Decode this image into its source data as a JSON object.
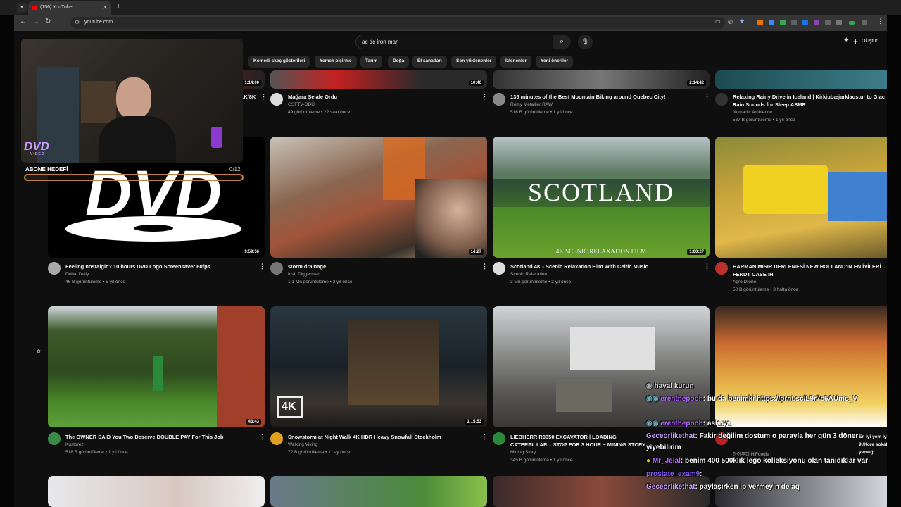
{
  "browser": {
    "tab_title": "(156) YouTube",
    "url": "youtube.com"
  },
  "header": {
    "search_query": "ac dc iron man",
    "create_label": "Oluştur"
  },
  "chips": [
    "Komedi skeç gösterileri",
    "Yemek pişirme",
    "Tarım",
    "Doğa",
    "El sanatları",
    "Son yüklenenler",
    "İzlenenler",
    "Yeni öneriler"
  ],
  "row1": [
    {
      "title": "...K/8K",
      "duration": "1:14:00"
    },
    {
      "title": "Mağara Şelale Ordu",
      "channel": "GSFTV-ODÜ",
      "meta": "49 görüntüleme • 22 saat önce",
      "duration": "10:46"
    },
    {
      "title": "135 minutes of the Best Mountain Biking around Quebec City!",
      "channel": "Rémy Métailler RAW",
      "meta": "516 B görüntüleme • 1 yıl önce",
      "duration": "2:14:42"
    },
    {
      "title": "Relaxing Rainy Drive in Iceland | Kirkjubæjarklaustur to Glac Rain Sounds for Sleep ASMR",
      "channel": "Nomadic Ambience",
      "meta": "537 B görüntüleme • 1 yıl önce"
    }
  ],
  "row2": [
    {
      "title": "Feeling nostalgic? 10 hours DVD Logo Screensaver 60fps",
      "channel": "Dubai Daily",
      "meta": "46 B görüntüleme • 5 yıl önce",
      "duration": "9:59:56"
    },
    {
      "title": "storm drainage",
      "channel": "Irish Diggerman",
      "meta": "1,1 Mn görüntüleme • 2 yıl önce",
      "duration": "14:27"
    },
    {
      "title": "Scotland 4K - Scenic Relaxation Film With Celtic Music",
      "channel": "Scenic Relaxation",
      "meta": "3 Mn görüntüleme • 3 yıl önce",
      "duration": "1:00:27",
      "thumb_title": "SCOTLAND",
      "thumb_sub": "4K SCENIC RELAXATION FILM"
    },
    {
      "title": "HARMAN MISIR DERLEMESİ NEW HOLLAND'IN EN İYİLERİ .. FENDT CASE IH",
      "channel": "Agro Drone",
      "meta": "50 B görüntüleme • 3 hafta önce"
    }
  ],
  "row3": [
    {
      "title": "The OWNER SAID You Two Deserve DOUBLE PAY For This Job",
      "channel": "Kustorez",
      "meta": "518 B görüntüleme • 1 yıl önce",
      "duration": "43:43"
    },
    {
      "title": "Snowstorm at Night Walk 4K HDR Heavy Snowfall Stockholm",
      "channel": "Walking Viking",
      "meta": "72 B görüntüleme • 11 ay önce",
      "duration": "1:15:53",
      "badge": "4K"
    },
    {
      "title": "LIEBHERR R9350 EXCAVATOR | LOADING CATERPILLAR... STOP FOR 3 HOUR ~ MINING STORY",
      "channel": "Mining Story",
      "meta": "345 B görüntüleme • 1 yıl önce"
    },
    {
      "title": "En iyi yem iyi 9 /Kore sokak yemeği",
      "channel": "하이푸디 HiFoodie"
    }
  ],
  "overlay": {
    "dvd_small": "DVD",
    "dvd_small_sub": "VIDEO",
    "goal_label": "ABONE HEDEFİ",
    "goal_count": "0/12",
    "dvd_big": "DVD"
  },
  "chat": [
    {
      "name": "",
      "msg": "hayal kurun"
    },
    {
      "name": "erenthepooh",
      "msg": ": bu da benimki https://prnt.sc/L9r7c6AUmc_V"
    },
    {
      "name": "erenthepooh",
      "msg": ": asla ya"
    },
    {
      "name": "Geceorlikethat",
      "msg": ": Fakir değilim dostum o parayla her gün 3 döner"
    },
    {
      "name": "",
      "msg": "yiyebilirim"
    },
    {
      "name": "Mr_Jelal",
      "msg": ": benim 400 500klık lego kolleksiyonu olan tanıdıklar var"
    },
    {
      "name": "prostate_exam9",
      "msg": ":"
    },
    {
      "name": "Geceorlikethat",
      "msg": ": paylaşırken ip vermeyin de aq"
    }
  ]
}
